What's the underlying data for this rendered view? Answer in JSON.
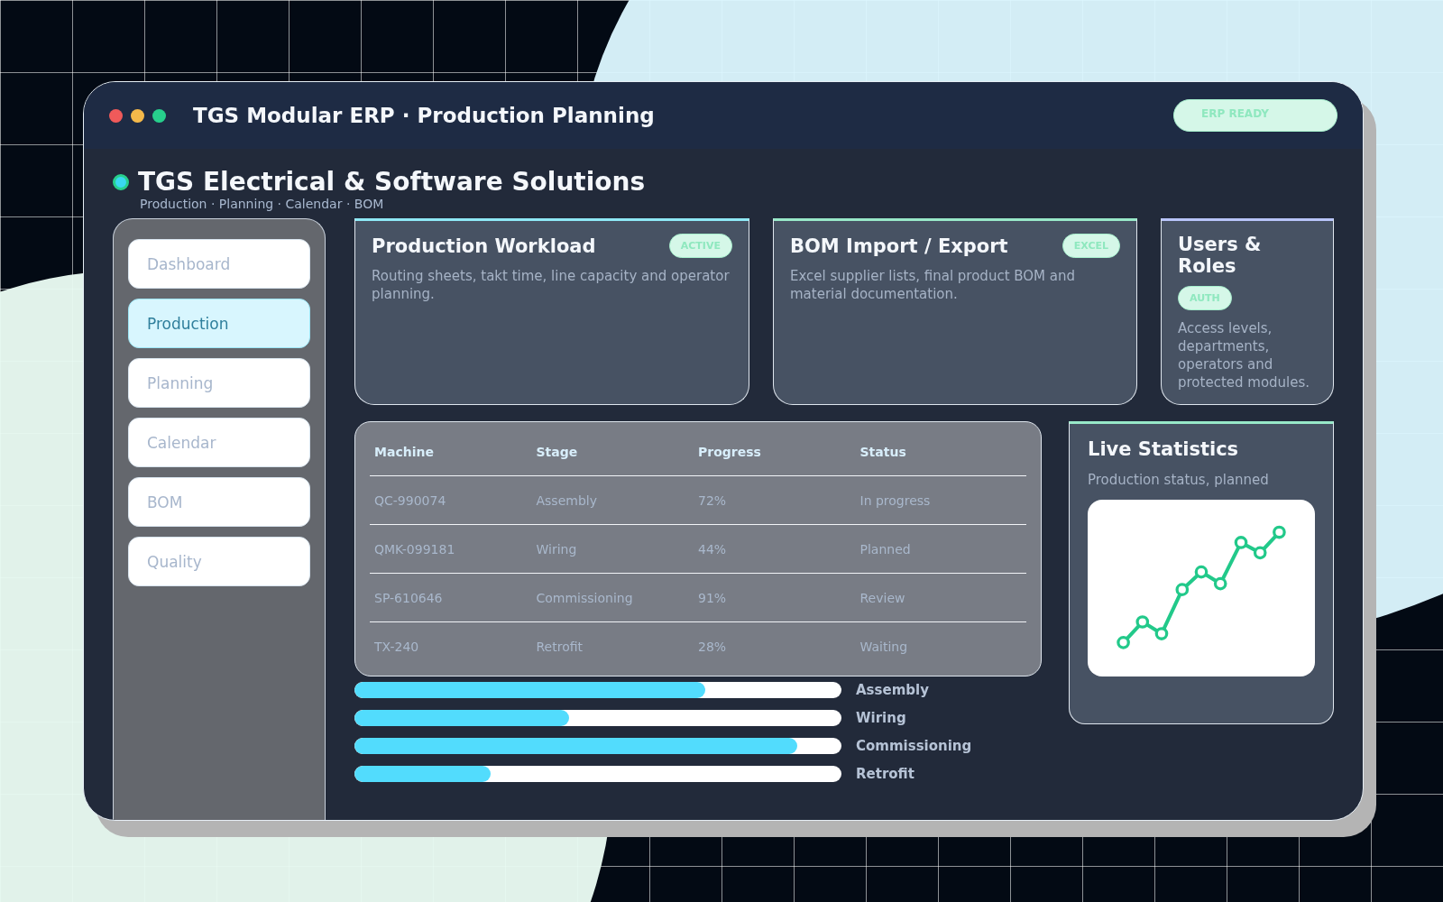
{
  "window": {
    "title": "TGS Modular ERP · Production Planning",
    "badge": "ERP READY"
  },
  "header": {
    "title": "TGS Electrical & Software Solutions",
    "subtitle": "Production · Planning · Calendar · BOM"
  },
  "sidebar": {
    "items": [
      {
        "label": "Dashboard",
        "selected": false
      },
      {
        "label": "Production",
        "selected": true
      },
      {
        "label": "Planning",
        "selected": false
      },
      {
        "label": "Calendar",
        "selected": false
      },
      {
        "label": "BOM",
        "selected": false
      },
      {
        "label": "Quality",
        "selected": false
      }
    ]
  },
  "cards": [
    {
      "title": "Production Workload",
      "badge": "ACTIVE",
      "text": "Routing sheets, takt time, line capacity and operator planning.",
      "color": "#8ee8f5"
    },
    {
      "title": "BOM Import / Export",
      "badge": "EXCEL",
      "text": "Excel supplier lists, final product BOM and material documentation.",
      "color": "#98e8c8"
    },
    {
      "title": "Users & Roles",
      "badge": "AUTH",
      "text": "Access levels, departments, operators and protected modules.",
      "color": "#b8c4f8"
    }
  ],
  "table": {
    "columns": [
      "Machine",
      "Stage",
      "Progress",
      "Status"
    ],
    "rows": [
      [
        "QC-990074",
        "Assembly",
        "72%",
        "In progress"
      ],
      [
        "QMK-099181",
        "Wiring",
        "44%",
        "Planned"
      ],
      [
        "SP-610646",
        "Commissioning",
        "91%",
        "Review"
      ],
      [
        "TX-240",
        "Retrofit",
        "28%",
        "Waiting"
      ]
    ]
  },
  "progress": [
    {
      "label": "Assembly",
      "level": 0.72
    },
    {
      "label": "Wiring",
      "level": 0.44
    },
    {
      "label": "Commissioning",
      "level": 0.91
    },
    {
      "label": "Retrofit",
      "level": 0.28
    }
  ],
  "stats": {
    "title": "Live Statistics",
    "text": "Production status, planned"
  }
}
